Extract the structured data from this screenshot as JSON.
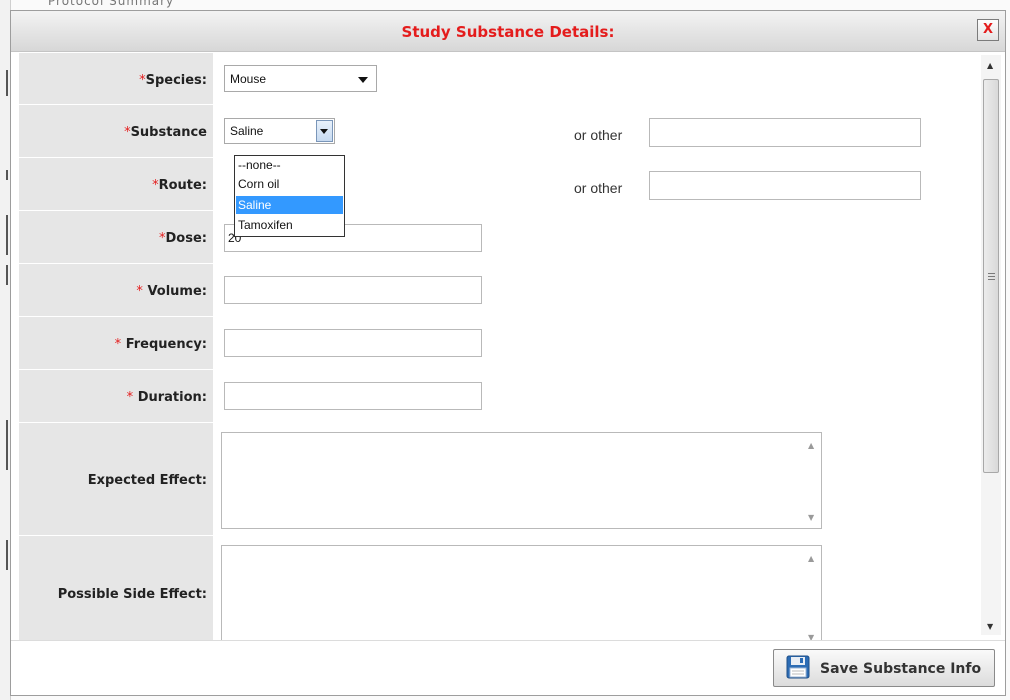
{
  "background": {
    "partial_text": "Protocol Summary"
  },
  "dialog": {
    "title": "Study Substance Details:",
    "close_label": "X"
  },
  "form": {
    "required_mark": "*",
    "species": {
      "label": "Species:",
      "value": "Mouse"
    },
    "substance": {
      "label": "Substance",
      "value": "Saline",
      "options": [
        "--none--",
        "Corn oil",
        "Saline",
        "Tamoxifen"
      ],
      "highlighted_option": "Saline",
      "other_label": "or other",
      "other_value": ""
    },
    "route": {
      "label": "Route:",
      "other_label": "or other",
      "other_value": ""
    },
    "dose": {
      "label": "Dose:",
      "value": "20"
    },
    "volume": {
      "label": "Volume:",
      "value": ""
    },
    "frequency": {
      "label": "Frequency:",
      "value": ""
    },
    "duration": {
      "label": "Duration:",
      "value": ""
    },
    "expected_effect": {
      "label": "Expected Effect:",
      "value": ""
    },
    "possible_side_effect": {
      "label": "Possible Side Effect:",
      "value": ""
    }
  },
  "footer": {
    "save_label": "Save Substance Info"
  },
  "colors": {
    "title": "#e41c1c",
    "required": "#e41c1c",
    "label_bg": "#e6e6e6",
    "selected_option": "#3399ff"
  }
}
